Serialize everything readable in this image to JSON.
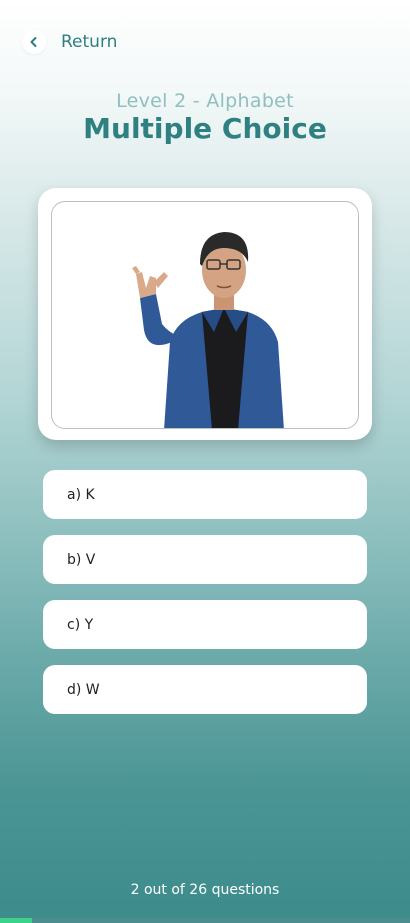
{
  "header": {
    "return_label": "Return"
  },
  "quiz": {
    "subtitle": "Level 2 - Alphabet",
    "title": "Multiple Choice",
    "options": [
      {
        "label": "a) K"
      },
      {
        "label": "b) V"
      },
      {
        "label": "c) Y"
      },
      {
        "label": "d) W"
      }
    ],
    "progress_text": "2 out of 26 questions",
    "progress_fraction": 0.077
  },
  "colors": {
    "accent": "#2f8081",
    "progress": "#3fd08a"
  },
  "icons": {
    "back": "chevron-left-icon"
  }
}
